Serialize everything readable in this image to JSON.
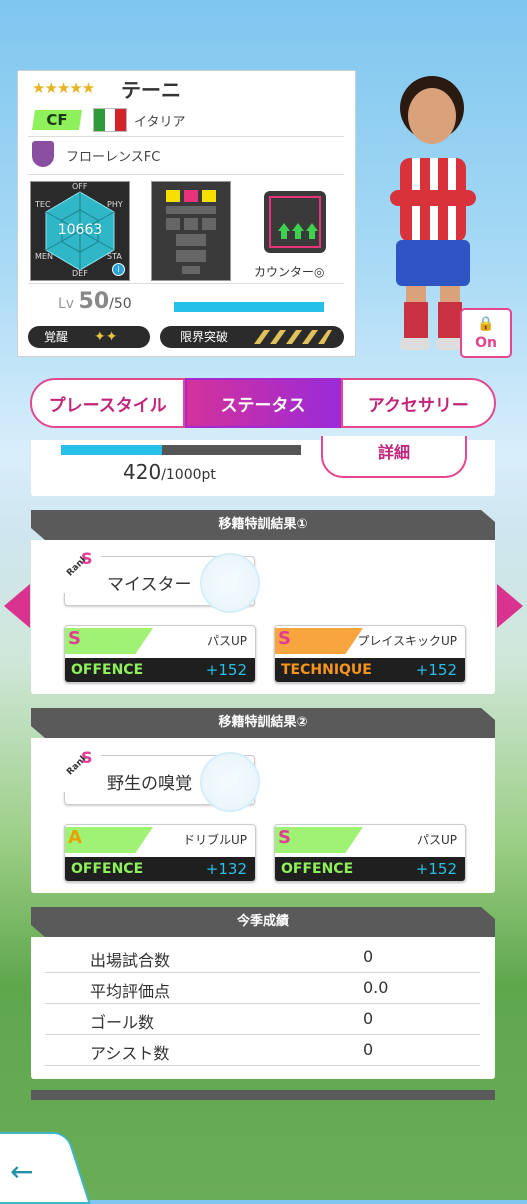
{
  "player": {
    "stars": "★★★★★",
    "name": "テーニ",
    "position": "CF",
    "country": "イタリア",
    "club": "フローレンスFC",
    "radar": {
      "labels": [
        "OFF",
        "PHY",
        "STA",
        "DEF",
        "MEN",
        "TEC"
      ],
      "value": "10663"
    },
    "counter_label": "カウンター◎",
    "level_prefix": "Lv",
    "level": "50",
    "level_max": "/50",
    "level_fill": 1.0,
    "awakening_label": "覚醒",
    "awakening_icons": "✦✦",
    "limit_label": "限界突破",
    "lock_state": "On"
  },
  "tabs": [
    "プレースタイル",
    "ステータス",
    "アクセサリー"
  ],
  "active_tab": 1,
  "points": {
    "current": "420",
    "suffix": "/1000pt",
    "fill": 0.42,
    "detail_button": "詳細"
  },
  "training": [
    {
      "header": "移籍特訓結果①",
      "rank_word": "Rank",
      "rank": "S",
      "title": "マイスター",
      "skills": [
        {
          "grade": "S",
          "name": "パスUP",
          "type": "OFFENCE",
          "value": "+152",
          "color": "#8ef05a",
          "grade_color": "#e23d95"
        },
        {
          "grade": "S",
          "name": "プレイスキックUP",
          "type": "TECHNIQUE",
          "value": "+152",
          "color": "#f7941d",
          "grade_color": "#e23d95"
        }
      ]
    },
    {
      "header": "移籍特訓結果②",
      "rank_word": "Rank",
      "rank": "S",
      "title": "野生の嗅覚",
      "skills": [
        {
          "grade": "A",
          "name": "ドリブルUP",
          "type": "OFFENCE",
          "value": "+132",
          "color": "#8ef05a",
          "grade_color": "#e8a200"
        },
        {
          "grade": "S",
          "name": "パスUP",
          "type": "OFFENCE",
          "value": "+152",
          "color": "#8ef05a",
          "grade_color": "#e23d95"
        }
      ]
    }
  ],
  "season": {
    "header": "今季成績",
    "rows": [
      {
        "label": "出場試合数",
        "value": "0"
      },
      {
        "label": "平均評価点",
        "value": "0.0"
      },
      {
        "label": "ゴール数",
        "value": "0"
      },
      {
        "label": "アシスト数",
        "value": "0"
      }
    ]
  },
  "back_icon": "←",
  "colors": {
    "accent": "#e4478f",
    "active_tab": "#a32ad0",
    "offence": "#8ef05a",
    "technique": "#f7941d",
    "value": "#27c0e8"
  }
}
